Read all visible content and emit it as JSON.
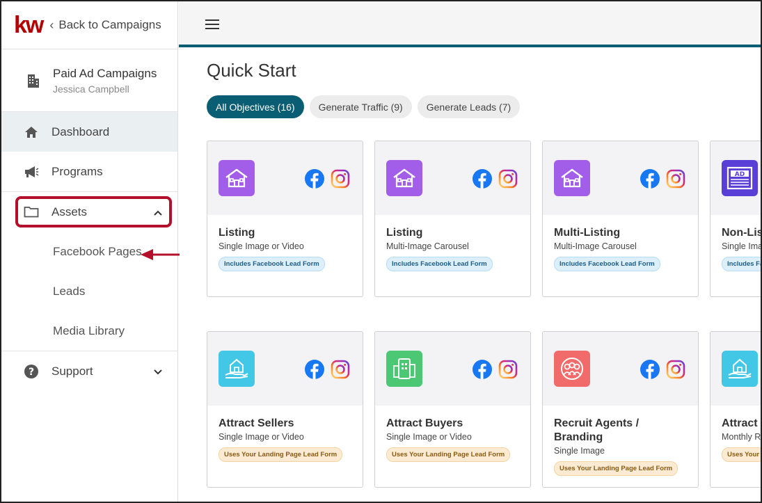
{
  "brand": {
    "logo": "kw",
    "back_label": "Back to Campaigns"
  },
  "account": {
    "title": "Paid Ad Campaigns",
    "subtitle": "Jessica Campbell"
  },
  "nav": {
    "dashboard": "Dashboard",
    "programs": "Programs",
    "assets": "Assets",
    "assets_sub": [
      "Facebook Pages",
      "Leads",
      "Media Library"
    ],
    "support": "Support"
  },
  "main": {
    "title": "Quick Start",
    "filters": [
      "All Objectives (16)",
      "Generate Traffic (9)",
      "Generate Leads (7)"
    ]
  },
  "cards": [
    {
      "name": "Listing",
      "format": "Single Image or Video",
      "badge": "Includes Facebook Lead Form",
      "icon": "house-icon",
      "color": "#a25ee8"
    },
    {
      "name": "Listing",
      "format": "Multi-Image Carousel",
      "badge": "Includes Facebook Lead Form",
      "icon": "house-icon",
      "color": "#a25ee8"
    },
    {
      "name": "Multi-Listing",
      "format": "Multi-Image Carousel",
      "badge": "Includes Facebook Lead Form",
      "icon": "house-icon",
      "color": "#a25ee8"
    },
    {
      "name": "Non-Lis",
      "format": "Single Ima",
      "badge": "Includes Fac",
      "icon": "ad-icon",
      "color": "#5a3fd6"
    },
    {
      "name": "Attract Sellers",
      "format": "Single Image or Video",
      "badge": "Uses Your Landing Page Lead Form",
      "icon": "hand-house-icon",
      "color": "#43c7e6"
    },
    {
      "name": "Attract Buyers",
      "format": "Single Image or Video",
      "badge": "Uses Your Landing Page Lead Form",
      "icon": "phone-building-icon",
      "color": "#4cc774"
    },
    {
      "name": "Recruit Agents / Branding",
      "format": "Single Image",
      "badge": "Uses Your Landing Page Lead Form",
      "icon": "group-icon",
      "color": "#f26b6b"
    },
    {
      "name": "Attract",
      "format": "Monthly Re",
      "badge": "Uses Your",
      "icon": "hand-house-icon",
      "color": "#43c7e6"
    }
  ],
  "colors": {
    "brand_red": "#b40101",
    "teal": "#0a5e74",
    "highlight": "#b4102b"
  }
}
